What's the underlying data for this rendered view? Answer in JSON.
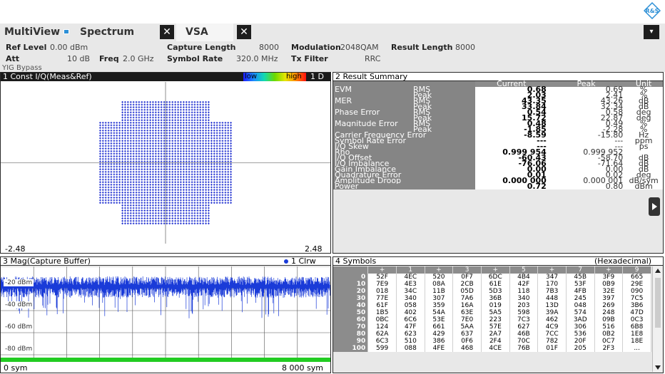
{
  "topbar": {
    "icon": "rs-logo-icon"
  },
  "tabs": {
    "multiview": "MultiView",
    "spectrum": "Spectrum",
    "vsa": "VSA",
    "close": "✕",
    "menu": "▾"
  },
  "info": {
    "ref_level_label": "Ref Level",
    "ref_level": "0.00 dBm",
    "att_label": "Att",
    "att": "10 dB",
    "freq_label": "Freq",
    "freq": "2.0 GHz",
    "yig": "YIG Bypass",
    "capture_length_label": "Capture Length",
    "capture_length": "8000",
    "symbol_rate_label": "Symbol Rate",
    "symbol_rate": "320.0 MHz",
    "modulation_label": "Modulation",
    "modulation": "2048QAM",
    "tx_filter_label": "Tx Filter",
    "tx_filter": "RRC",
    "result_length_label": "Result Length",
    "result_length": "8000"
  },
  "win1": {
    "title": "1 Const I/Q(Meas&Ref)",
    "low": "low",
    "high": "high",
    "mode": "1 D",
    "xmin": "-2.48",
    "xmax": "2.48"
  },
  "win2": {
    "title": "2 Result Summary",
    "headers": [
      "Current",
      "Peak",
      "Unit"
    ],
    "rows": [
      {
        "name": "EVM",
        "sub": "RMS",
        "current": "0.68",
        "peak": "0.69",
        "unit": "%"
      },
      {
        "name": "",
        "sub": "Peak",
        "current": "2.03",
        "peak": "2.41",
        "unit": "%"
      },
      {
        "name": "MER",
        "sub": "RMS",
        "current": "43.35",
        "peak": "43.26",
        "unit": "dB"
      },
      {
        "name": "",
        "sub": "Peak",
        "current": "33.84",
        "peak": "32.34",
        "unit": "dB"
      },
      {
        "name": "Phase Error",
        "sub": "RMS",
        "current": "0.54",
        "peak": "0.58",
        "unit": "deg"
      },
      {
        "name": "",
        "sub": "Peak",
        "current": "15.72",
        "peak": "22.87",
        "unit": "deg"
      },
      {
        "name": "Magnitude Error",
        "sub": "RMS",
        "current": "0.48",
        "peak": "0.49",
        "unit": "%"
      },
      {
        "name": "",
        "sub": "Peak",
        "current": "-1.85",
        "peak": "-2.28",
        "unit": "%"
      },
      {
        "name": "Carrier Frequency Error",
        "sub": "",
        "current": "-8.59",
        "peak": "-15.80",
        "unit": "Hz"
      },
      {
        "name": "Symbol Rate Error",
        "sub": "",
        "current": "---",
        "peak": "---",
        "unit": "ppm"
      },
      {
        "name": "I/Q Skew",
        "sub": "",
        "current": "---",
        "peak": "---",
        "unit": "ps"
      },
      {
        "name": "Rho",
        "sub": "",
        "current": "0.999 954",
        "peak": "0.999 952",
        "unit": ""
      },
      {
        "name": "I/Q Offset",
        "sub": "",
        "current": "-60.43",
        "peak": "-58.70",
        "unit": "dB"
      },
      {
        "name": "I/Q Imbalance",
        "sub": "",
        "current": "-76.06",
        "peak": "-71.64",
        "unit": "dB"
      },
      {
        "name": "Gain Imbalance",
        "sub": "",
        "current": "0.00",
        "peak": "0.00",
        "unit": "dB"
      },
      {
        "name": "Quadrature Error",
        "sub": "",
        "current": "0.01",
        "peak": "0.02",
        "unit": "deg"
      },
      {
        "name": "Amplitude Droop",
        "sub": "",
        "current": "0.000 000",
        "peak": "0.000 001",
        "unit": "dB/sym"
      },
      {
        "name": "Power",
        "sub": "",
        "current": "0.72",
        "peak": "0.80",
        "unit": "dBm"
      }
    ]
  },
  "win3": {
    "title": "3 Mag(Capture Buffer)",
    "trace": "1 Clrw",
    "xmin": "0 sym",
    "xmax": "8 000 sym",
    "ylabels": [
      "-20 dBm",
      "-40 dBm",
      "-60 dBm",
      "-80 dBm"
    ]
  },
  "win4": {
    "title": "4 Symbols",
    "format": "(Hexadecimal)",
    "cols": [
      "+",
      "1",
      "+",
      "3",
      "+",
      "5",
      "+",
      "7",
      "+",
      "9"
    ],
    "rows": [
      {
        "idx": "0",
        "v": [
          "52F",
          "4EC",
          "520",
          "0F7",
          "6DC",
          "4B4",
          "347",
          "45B",
          "3F9",
          "665"
        ]
      },
      {
        "idx": "10",
        "v": [
          "7E9",
          "4E3",
          "08A",
          "2CB",
          "61E",
          "42F",
          "170",
          "53F",
          "0B9",
          "29E"
        ]
      },
      {
        "idx": "20",
        "v": [
          "018",
          "34C",
          "11B",
          "05D",
          "5D3",
          "118",
          "7B3",
          "4FB",
          "32E",
          "090"
        ]
      },
      {
        "idx": "30",
        "v": [
          "77E",
          "340",
          "307",
          "7A6",
          "36B",
          "340",
          "448",
          "245",
          "397",
          "7C5"
        ]
      },
      {
        "idx": "40",
        "v": [
          "61F",
          "058",
          "359",
          "16A",
          "019",
          "203",
          "13D",
          "048",
          "269",
          "3B6"
        ]
      },
      {
        "idx": "50",
        "v": [
          "1B5",
          "402",
          "54A",
          "63E",
          "5A5",
          "598",
          "39A",
          "574",
          "248",
          "47D"
        ]
      },
      {
        "idx": "60",
        "v": [
          "0BC",
          "6C6",
          "53E",
          "7E0",
          "223",
          "7C3",
          "462",
          "3AD",
          "09B",
          "0C3"
        ]
      },
      {
        "idx": "70",
        "v": [
          "124",
          "47F",
          "661",
          "5AA",
          "57E",
          "627",
          "4C9",
          "306",
          "516",
          "6B8"
        ]
      },
      {
        "idx": "80",
        "v": [
          "62A",
          "623",
          "429",
          "637",
          "2A7",
          "46B",
          "7CC",
          "536",
          "0B2",
          "1E8"
        ]
      },
      {
        "idx": "90",
        "v": [
          "6C3",
          "510",
          "386",
          "0F6",
          "2F4",
          "70C",
          "782",
          "20F",
          "0C7",
          "18E"
        ]
      },
      {
        "idx": "100",
        "v": [
          "599",
          "088",
          "4FE",
          "468",
          "4CE",
          "76B",
          "01F",
          "205",
          "2F3",
          "..."
        ]
      }
    ]
  },
  "colors": {
    "background": "#e8e8e8",
    "constellation": "#1f2fd0",
    "trace": "#1a3bd8",
    "limit_line": "#22cc22"
  }
}
